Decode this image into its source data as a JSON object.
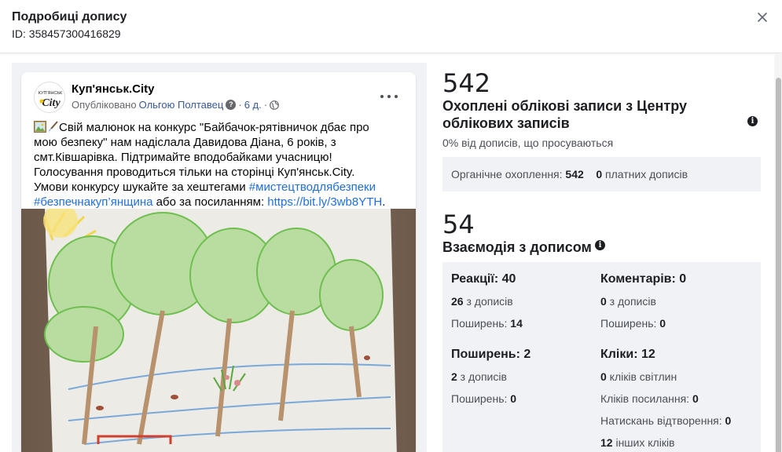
{
  "header": {
    "title": "Подробиці допису",
    "post_id": "ID: 358457300416829"
  },
  "post": {
    "page_name": "Куп'янськ.City",
    "avatar_text": "КУП'ЯНСЬК City",
    "published_prefix": "Опубліковано",
    "author": "Ольгою Полтавец",
    "question_mark": "?",
    "dot1": "·",
    "age": "6 д.",
    "dot2": "·",
    "text_l1": "Свій малюнок на конкурс \"Байбачок-рятівничок дбає про",
    "text_l2": "мою безпеку\" нам надіслала Давидова Діана, 6  років, з",
    "text_l3": "смт.Ківшарівка. Підтримайте вподобайками учасницю!",
    "text_l4": "Голосування проводиться тільки на сторінці Куп'янськ.City.",
    "text_l5": "Умови конкурсу шукайте за хештегами ",
    "hashtag1": "#мистецтводлябезпеки",
    "hashtag2": "#безпечнакуп’янщина",
    "text_l6_mid": " або за посиланням: ",
    "link": "https://bit.ly/3wb8YTH",
    "text_l6_end": "."
  },
  "reach": {
    "number": "542",
    "title": "Охоплені облікові записи з Центру облікових записів",
    "subtitle": "0% від дописів, що просуваються",
    "organic_label": "Органічне охоплення: ",
    "organic_value": "542",
    "paid_value": "0",
    "paid_label": " платних дописів"
  },
  "engagement": {
    "number": "54",
    "title": "Взаємодія з дописом",
    "reactions_head": "Реакції: 40",
    "reactions_from_posts_value": "26",
    "reactions_from_posts_label": " з дописів",
    "reactions_shares_label": "Поширень: ",
    "reactions_shares_value": "14",
    "comments_head": "Коментарів: 0",
    "comments_from_posts_value": "0",
    "comments_from_posts_label": " з дописів",
    "comments_shares_label": "Поширень: ",
    "comments_shares_value": "0",
    "shares_head": "Поширень: 2",
    "shares_from_posts_value": "2",
    "shares_from_posts_label": " з дописів",
    "shares_shares_label": "Поширень: ",
    "shares_shares_value": "0",
    "clicks_head": "Кліки: 12",
    "clicks_photo_value": "0",
    "clicks_photo_label": " кліків світлин",
    "clicks_link_label": "Кліків посилання: ",
    "clicks_link_value": "0",
    "clicks_play_label": "Натискань відтворення: ",
    "clicks_play_value": "0",
    "clicks_other_value": "12",
    "clicks_other_label": " інших кліків"
  },
  "colors": {
    "link": "#385898",
    "hashtag": "#216fdb",
    "panel_bg": "#f0f2f5"
  },
  "icons": {
    "close": "close-icon",
    "more": "more-options-icon",
    "globe": "globe-icon",
    "info": "info-icon",
    "picture": "picture-emoji-icon",
    "brush": "paintbrush-emoji-icon"
  }
}
